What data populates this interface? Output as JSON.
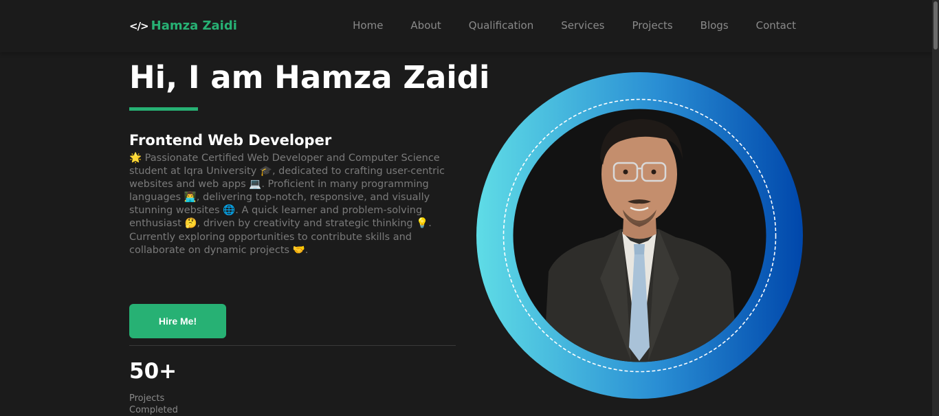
{
  "header": {
    "logo_text": "Hamza Zaidi",
    "logo_icon": "code-icon",
    "nav": [
      "Home",
      "About",
      "Qualification",
      "Services",
      "Projects",
      "Blogs",
      "Contact"
    ]
  },
  "hero": {
    "title": "Hi, I am Hamza Zaidi",
    "role": "Frontend Web Developer",
    "bio": "🌟 Passionate Certified Web Developer and Computer Science student at Iqra University 🎓, dedicated to crafting user-centric websites and web apps 💻. Proficient in many programming languages 👨‍💻, delivering top-notch, responsive, and visually stunning websites 🌐. A quick learner and problem-solving enthusiast 🤔, driven by creativity and strategic thinking 💡. Currently exploring opportunities to contribute skills and collaborate on dynamic projects 🤝.",
    "hire_label": "Hire Me!",
    "stat_number": "50+",
    "stat_label": "Projects Completed"
  },
  "colors": {
    "accent": "#27b174",
    "background": "#1b1b1b",
    "ring_start": "#5fdce6",
    "ring_end": "#0047ab"
  }
}
